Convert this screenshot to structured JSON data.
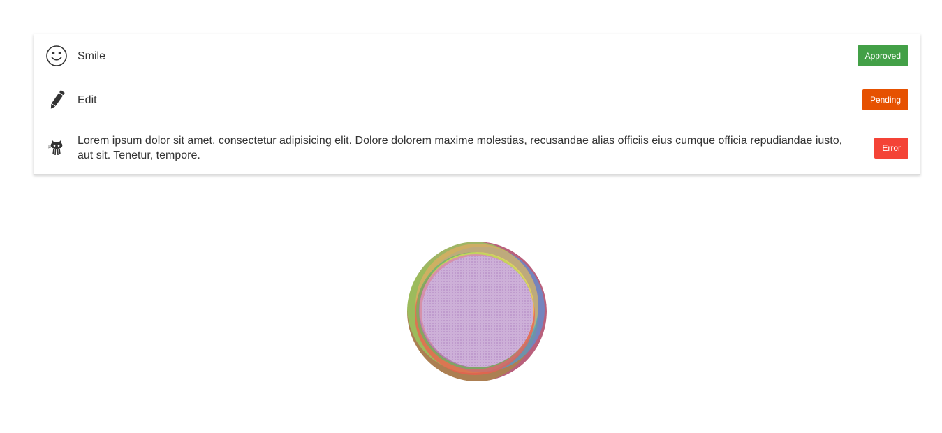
{
  "list": {
    "items": [
      {
        "icon": "smile-icon",
        "text": "Smile",
        "status": "Approved",
        "status_color": "#43a047"
      },
      {
        "icon": "pencil-icon",
        "text": "Edit",
        "status": "Pending",
        "status_color": "#e65100"
      },
      {
        "icon": "github-octocat-icon",
        "text": "Lorem ipsum dolor sit amet, consectetur adipisicing elit. Dolore dolorem maxime molestias, recusandae alias officiis eius cumque officia repudiandae iusto, aut sit. Tenetur, tempore.",
        "status": "Error",
        "status_color": "#f44336"
      }
    ]
  },
  "graphic": {
    "icon": "color-orb-loader",
    "colors": [
      "#8bc34a",
      "#e91e63",
      "#2196f3",
      "#ff9800",
      "#ffeb3b",
      "#9c27b0",
      "#4caf50",
      "#f44336"
    ]
  }
}
